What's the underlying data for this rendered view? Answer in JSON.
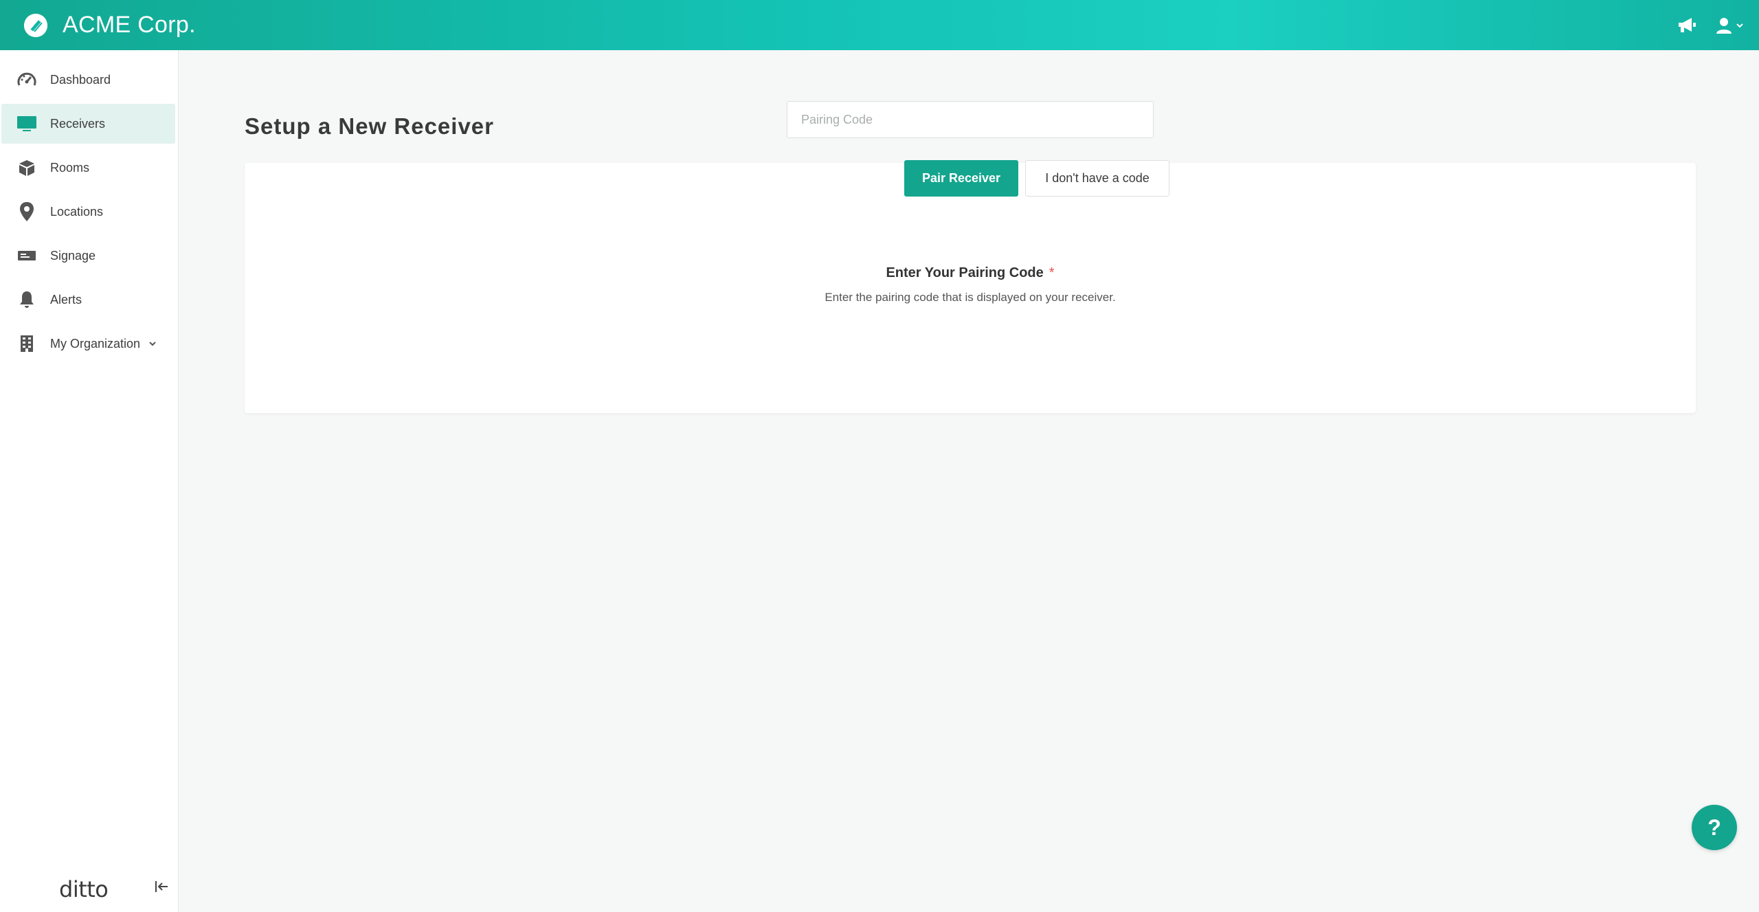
{
  "header": {
    "brand_name": "ACME Corp.",
    "logo_icon": "acme-logo-icon",
    "announcements_icon": "megaphone-icon",
    "user_menu_icon": "user-icon"
  },
  "sidebar": {
    "items": [
      {
        "label": "Dashboard",
        "icon": "gauge-icon"
      },
      {
        "label": "Receivers",
        "icon": "monitor-icon",
        "active": true
      },
      {
        "label": "Rooms",
        "icon": "cube-icon"
      },
      {
        "label": "Locations",
        "icon": "map-pin-icon"
      },
      {
        "label": "Signage",
        "icon": "signage-icon"
      },
      {
        "label": "Alerts",
        "icon": "bell-icon"
      },
      {
        "label": "My Organization",
        "icon": "building-icon",
        "has_submenu": true
      }
    ],
    "footer_logo": "ditto",
    "collapse_icon": "collapse-left-icon"
  },
  "main": {
    "page_title": "Setup a New Receiver",
    "form": {
      "field_label": "Enter Your Pairing Code",
      "required_mark": "*",
      "help_text": "Enter the pairing code that is displayed on your receiver.",
      "input_value": "",
      "input_placeholder": "Pairing Code",
      "primary_button": "Pair Receiver",
      "secondary_button": "I don't have a code"
    },
    "help_button": "?"
  },
  "colors": {
    "accent": "#14a58e",
    "header_gradient_start": "#12a892",
    "header_gradient_mid": "#1bcfc1",
    "active_nav_bg": "#e2f2ef",
    "required": "#e8504a",
    "icon_gray": "#555555"
  }
}
